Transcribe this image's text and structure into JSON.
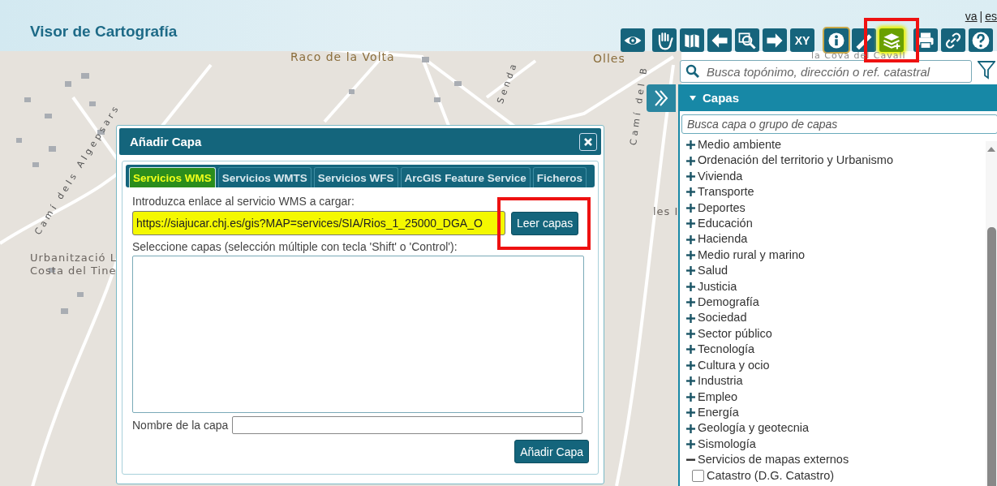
{
  "map": {
    "labels": [
      {
        "kind": "place",
        "text": "Raco de la Volta"
      },
      {
        "kind": "place",
        "text": "Olles"
      },
      {
        "kind": "place",
        "text": "Urbanització L"
      },
      {
        "kind": "place",
        "text": "Costa del Tine"
      },
      {
        "kind": "place",
        "text": "les I"
      },
      {
        "kind": "faint",
        "text": "la Cova del Cavall"
      },
      {
        "kind": "street",
        "text": "Camí dels Algepsars"
      },
      {
        "kind": "street",
        "text": "Senda"
      },
      {
        "kind": "street",
        "text": "Camí del B"
      }
    ]
  },
  "header": {
    "title": "Visor de Cartografía",
    "languages": [
      {
        "label": "va"
      },
      {
        "label": "es"
      }
    ],
    "separator": "|"
  },
  "toolbar": [
    {
      "kind": "eye",
      "active": false,
      "highlighted": false,
      "framed": false
    },
    {
      "kind": "hand",
      "active": false,
      "highlighted": false,
      "framed": false
    },
    {
      "kind": "map",
      "active": false,
      "highlighted": false,
      "framed": false
    },
    {
      "kind": "back",
      "active": false,
      "highlighted": false,
      "framed": false
    },
    {
      "kind": "zoom",
      "active": false,
      "highlighted": false,
      "framed": false
    },
    {
      "kind": "forward",
      "active": false,
      "highlighted": false,
      "framed": false
    },
    {
      "kind": "xy",
      "label": "XY",
      "active": false,
      "highlighted": false,
      "framed": false
    },
    {
      "kind": "info",
      "active": true,
      "highlighted": false,
      "framed": false
    },
    {
      "kind": "ruler",
      "active": false,
      "highlighted": false,
      "framed": false
    },
    {
      "kind": "layers",
      "active": false,
      "highlighted": true,
      "framed": true
    },
    {
      "kind": "print",
      "active": false,
      "highlighted": false,
      "framed": false
    },
    {
      "kind": "link",
      "active": false,
      "highlighted": false,
      "framed": false
    },
    {
      "kind": "help",
      "active": false,
      "highlighted": false,
      "framed": false
    }
  ],
  "search": {
    "placeholder": "Busca topónimo, dirección o ref. catastral"
  },
  "panel": {
    "expanded": true,
    "title": "Capas",
    "search_placeholder": "Busca capa o grupo de capas",
    "tree": [
      {
        "label": "Medio ambiente",
        "expanded": false
      },
      {
        "label": "Ordenación del territorio y Urbanismo",
        "expanded": false
      },
      {
        "label": "Vivienda",
        "expanded": false
      },
      {
        "label": "Transporte",
        "expanded": false
      },
      {
        "label": "Deportes",
        "expanded": false
      },
      {
        "label": "Educación",
        "expanded": false
      },
      {
        "label": "Hacienda",
        "expanded": false
      },
      {
        "label": "Medio rural y marino",
        "expanded": false
      },
      {
        "label": "Salud",
        "expanded": false
      },
      {
        "label": "Justicia",
        "expanded": false
      },
      {
        "label": "Demografía",
        "expanded": false
      },
      {
        "label": "Sociedad",
        "expanded": false
      },
      {
        "label": "Sector público",
        "expanded": false
      },
      {
        "label": "Tecnología",
        "expanded": false
      },
      {
        "label": "Cultura y ocio",
        "expanded": false
      },
      {
        "label": "Industria",
        "expanded": false
      },
      {
        "label": "Empleo",
        "expanded": false
      },
      {
        "label": "Energía",
        "expanded": false
      },
      {
        "label": "Geología y geotecnia",
        "expanded": false
      },
      {
        "label": "Sismología",
        "expanded": false
      },
      {
        "label": "Servicios de mapas externos",
        "expanded": true,
        "children": [
          {
            "label": "Catastro (D.G. Catastro)",
            "checked": false
          }
        ]
      }
    ]
  },
  "dialog": {
    "title": "Añadir Capa",
    "tabs": [
      {
        "label": "Servicios WMS",
        "selected": true,
        "highlighted": true
      },
      {
        "label": "Servicios WMTS",
        "selected": false,
        "highlighted": false
      },
      {
        "label": "Servicios WFS",
        "selected": false,
        "highlighted": false
      },
      {
        "label": "ArcGIS Feature Service",
        "selected": false,
        "highlighted": false
      },
      {
        "label": "Ficheros",
        "selected": false,
        "highlighted": false
      }
    ],
    "url_label": "Introduzca enlace al servicio WMS a cargar:",
    "url_value": "https://siajucar.chj.es/gis?MAP=services/SIA/Rios_1_25000_DGA_O",
    "url_highlighted": true,
    "read_button": {
      "label": "Leer capas",
      "framed": true
    },
    "layers_label": "Seleccione capas (selección múltiple con tecla 'Shift' o 'Control'):",
    "name_label": "Nombre de la capa",
    "add_button": "Añadir Capa"
  }
}
